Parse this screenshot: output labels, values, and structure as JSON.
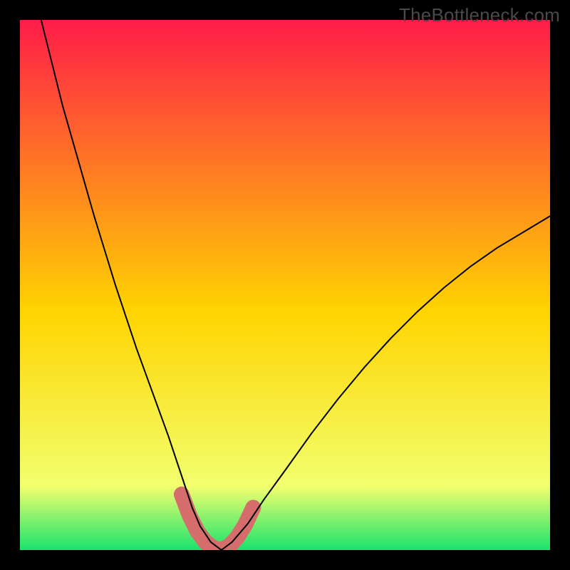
{
  "watermark": "TheBottleneck.com",
  "chart_data": {
    "type": "line",
    "title": "",
    "xlabel": "",
    "ylabel": "",
    "xlim": [
      0,
      100
    ],
    "ylim": [
      0,
      100
    ],
    "grid": false,
    "legend": false,
    "background_gradient": {
      "top_color": "#ff1c49",
      "mid_color": "#ffd400",
      "lower_color": "#f2ff6e",
      "bottom_color": "#19e36d"
    },
    "series": [
      {
        "name": "bottleneck-curve",
        "color": "#000000",
        "stroke_width": 2,
        "x": [
          4,
          6,
          8,
          10,
          12,
          14,
          16,
          18,
          20,
          22,
          24,
          26,
          28,
          29.5,
          31,
          32.5,
          34,
          36,
          38,
          40,
          43,
          46,
          50,
          55,
          60,
          65,
          70,
          75,
          80,
          85,
          90,
          95,
          100
        ],
        "y": [
          100,
          92,
          84,
          77,
          70,
          63,
          56.5,
          50,
          44,
          38,
          32.5,
          27,
          21.5,
          17,
          12.5,
          8,
          4.5,
          1.5,
          0,
          1.5,
          5,
          9.5,
          15,
          22,
          28.5,
          34.5,
          40,
          45,
          49.5,
          53.5,
          57,
          60,
          63
        ]
      },
      {
        "name": "highlight-valley",
        "color": "#d66d6d",
        "stroke_width": 22,
        "linecap": "round",
        "x": [
          30.5,
          32,
          33.5,
          35,
          36.5,
          38,
          39.5,
          41,
          42.5,
          44
        ],
        "y": [
          10.5,
          6.5,
          3.5,
          1.5,
          0.4,
          0,
          0.8,
          2.4,
          4.8,
          8
        ]
      }
    ]
  }
}
